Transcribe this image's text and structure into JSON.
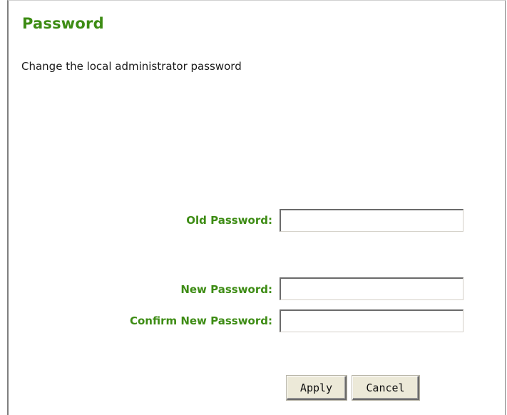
{
  "page": {
    "title": "Password",
    "description": "Change the local administrator password"
  },
  "form": {
    "old_password": {
      "label": "Old Password:",
      "value": ""
    },
    "new_password": {
      "label": "New Password:",
      "value": ""
    },
    "confirm_new_password": {
      "label": "Confirm New Password:",
      "value": ""
    }
  },
  "actions": {
    "apply_label": "Apply",
    "cancel_label": "Cancel"
  },
  "colors": {
    "accent_green": "#3d8c14",
    "button_face": "#ece9d8",
    "text": "#1a1a1a"
  }
}
